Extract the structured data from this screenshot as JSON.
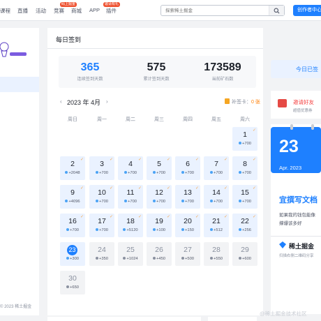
{
  "header": {
    "nav": [
      {
        "label": "课程",
        "badge": ""
      },
      {
        "label": "直播",
        "badge": ""
      },
      {
        "label": "活动",
        "badge": ""
      },
      {
        "label": "竞赛",
        "badge": "码上掘金"
      },
      {
        "label": "商城",
        "badge": ""
      },
      {
        "label": "APP",
        "badge": "邀请有礼"
      },
      {
        "label": "插件",
        "badge": ""
      }
    ],
    "search_placeholder": "探索稀土掘金",
    "creator_button": "创作者中心"
  },
  "sidebar": {
    "copyright": "© 2023 稀土掘金"
  },
  "main": {
    "title": "每日签到",
    "stats": [
      {
        "value": "365",
        "label": "连续签到天数"
      },
      {
        "value": "575",
        "label": "累计签到天数"
      },
      {
        "value": "173589",
        "label": "当前矿石数"
      }
    ],
    "month": "2023 年 4月",
    "prev_icon": "chevron-left-icon",
    "next_icon": "chevron-right-icon",
    "patch_label": "补签卡：",
    "patch_count": "0 张",
    "weekdays": [
      "周日",
      "周一",
      "周二",
      "周三",
      "周四",
      "周五",
      "周六"
    ]
  },
  "calendar": [
    {
      "day": "1",
      "pts": "+700",
      "status": "signed"
    },
    {
      "day": "2",
      "pts": "+2048",
      "status": "signed"
    },
    {
      "day": "3",
      "pts": "+700",
      "status": "signed"
    },
    {
      "day": "4",
      "pts": "+700",
      "status": "signed"
    },
    {
      "day": "5",
      "pts": "+700",
      "status": "signed"
    },
    {
      "day": "6",
      "pts": "+700",
      "status": "signed"
    },
    {
      "day": "7",
      "pts": "+700",
      "status": "signed"
    },
    {
      "day": "8",
      "pts": "+700",
      "status": "signed"
    },
    {
      "day": "9",
      "pts": "+4096",
      "status": "signed"
    },
    {
      "day": "10",
      "pts": "+700",
      "status": "signed"
    },
    {
      "day": "11",
      "pts": "+700",
      "status": "signed"
    },
    {
      "day": "12",
      "pts": "+700",
      "status": "signed"
    },
    {
      "day": "13",
      "pts": "+700",
      "status": "signed"
    },
    {
      "day": "14",
      "pts": "+700",
      "status": "signed"
    },
    {
      "day": "15",
      "pts": "+700",
      "status": "signed"
    },
    {
      "day": "16",
      "pts": "+700",
      "status": "signed"
    },
    {
      "day": "17",
      "pts": "+700",
      "status": "signed"
    },
    {
      "day": "18",
      "pts": "+5120",
      "status": "signed"
    },
    {
      "day": "19",
      "pts": "+100",
      "status": "signed"
    },
    {
      "day": "20",
      "pts": "+150",
      "status": "signed"
    },
    {
      "day": "21",
      "pts": "+512",
      "status": "signed"
    },
    {
      "day": "22",
      "pts": "+256",
      "status": "signed"
    },
    {
      "day": "23",
      "pts": "+300",
      "status": "today"
    },
    {
      "day": "24",
      "pts": "+350",
      "status": "future"
    },
    {
      "day": "25",
      "pts": "+1024",
      "status": "future"
    },
    {
      "day": "26",
      "pts": "+450",
      "status": "future"
    },
    {
      "day": "27",
      "pts": "+500",
      "status": "future"
    },
    {
      "day": "28",
      "pts": "+550",
      "status": "future"
    },
    {
      "day": "29",
      "pts": "+600",
      "status": "future"
    },
    {
      "day": "30",
      "pts": "+650",
      "status": "future"
    }
  ],
  "right": {
    "signin_button": "今日已签",
    "invite_title": "邀请好友",
    "invite_sub": "超值优惠券",
    "cal_day": "23",
    "cal_month": "Apr. 2023",
    "promo_title": "宜撰写文档",
    "promo_lines": [
      "如果我的钱包能像",
      "撑爆该多好"
    ],
    "brand": "稀土掘金",
    "brand_sub": "扫描右侧二维码分享"
  },
  "watermark": "@稀土掘金技术社区",
  "colors": {
    "accent": "#1e80ff",
    "signed_bg": "#eaf2ff",
    "future_bg": "#f2f3f5",
    "check": "#f6a44b"
  }
}
